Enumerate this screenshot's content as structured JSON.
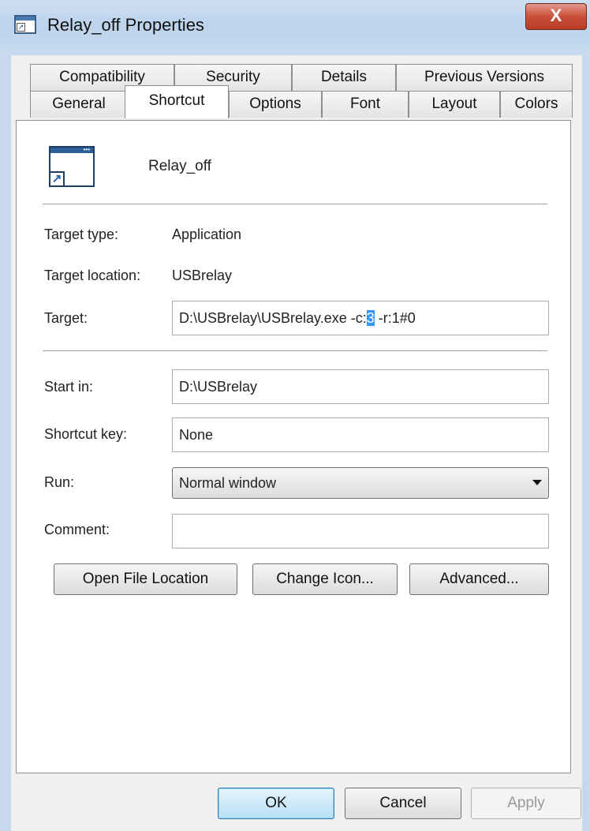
{
  "window": {
    "title": "Relay_off Properties",
    "close_label": "X"
  },
  "tabs_row1": [
    {
      "label": "Compatibility"
    },
    {
      "label": "Security"
    },
    {
      "label": "Details"
    },
    {
      "label": "Previous Versions"
    }
  ],
  "tabs_row2": [
    {
      "label": "General"
    },
    {
      "label": "Shortcut"
    },
    {
      "label": "Options"
    },
    {
      "label": "Font"
    },
    {
      "label": "Layout"
    },
    {
      "label": "Colors"
    }
  ],
  "active_tab": "Shortcut",
  "shortcut": {
    "name": "Relay_off",
    "target_type_label": "Target type:",
    "target_type_value": "Application",
    "target_location_label": "Target location:",
    "target_location_value": "USBrelay",
    "target_label": "Target:",
    "target_value_before": "D:\\USBrelay\\USBrelay.exe -c:",
    "target_value_selected": "3",
    "target_value_after": " -r:1#0",
    "start_in_label": "Start in:",
    "start_in_value": "D:\\USBrelay",
    "shortcut_key_label": "Shortcut key:",
    "shortcut_key_value": "None",
    "run_label": "Run:",
    "run_value": "Normal window",
    "comment_label": "Comment:",
    "comment_value": ""
  },
  "buttons": {
    "open_file_location": "Open File Location",
    "change_icon": "Change Icon...",
    "advanced": "Advanced...",
    "ok": "OK",
    "cancel": "Cancel",
    "apply": "Apply"
  }
}
